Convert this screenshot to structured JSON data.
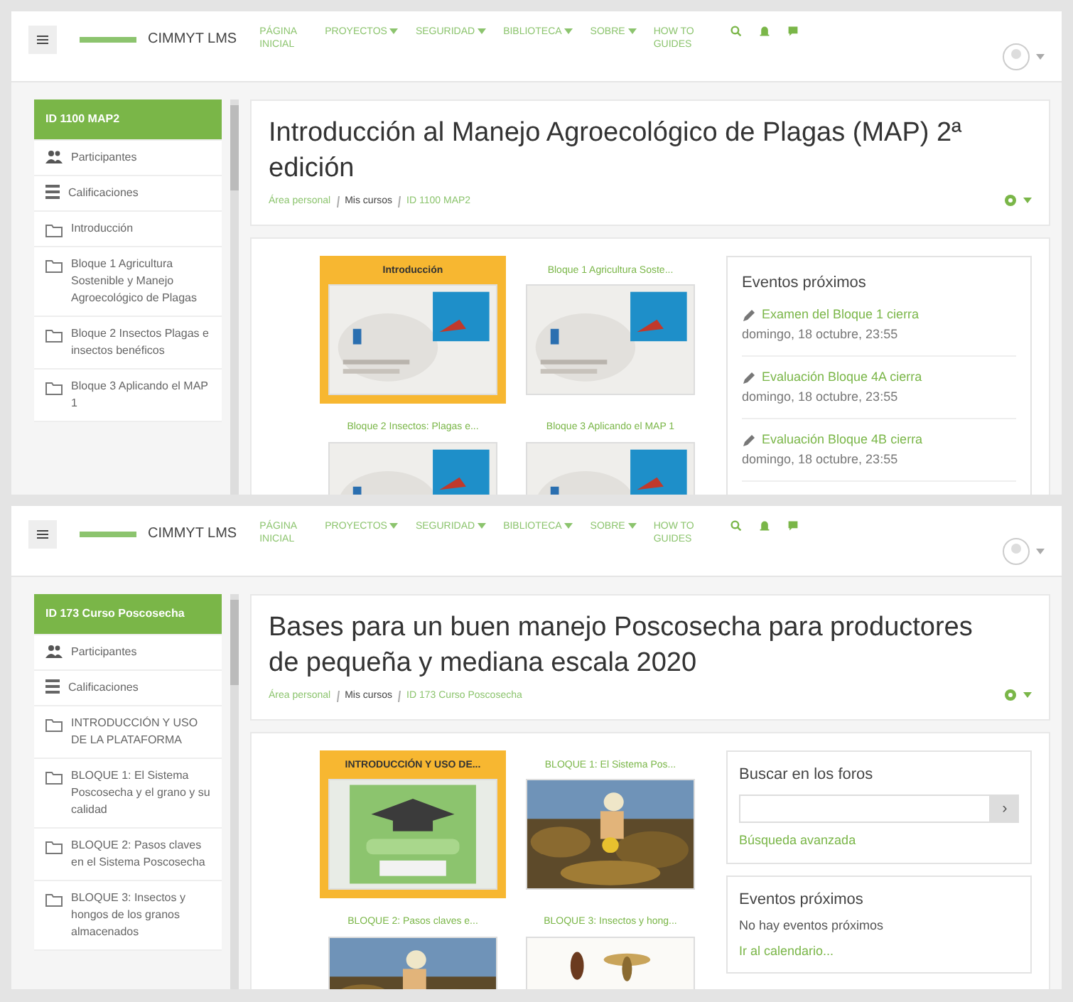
{
  "screens": [
    {
      "header": {
        "brand": "CIMMYT LMS",
        "nav": [
          {
            "label": "PÁGINA INICIAL",
            "dropdown": false
          },
          {
            "label": "PROYECTOS",
            "dropdown": true
          },
          {
            "label": "SEGURIDAD",
            "dropdown": true
          },
          {
            "label": "BIBLIOTECA",
            "dropdown": true
          },
          {
            "label": "SOBRE",
            "dropdown": true
          },
          {
            "label": "HOW TO GUIDES",
            "dropdown": false
          }
        ]
      },
      "sidebar": [
        {
          "kind": "course",
          "label": "ID 1100 MAP2",
          "selected": true
        },
        {
          "kind": "people",
          "label": "Participantes",
          "selected": false
        },
        {
          "kind": "grades",
          "label": "Calificaciones",
          "selected": false
        },
        {
          "kind": "section",
          "label": "Introducción",
          "selected": false
        },
        {
          "kind": "section",
          "label": "Bloque 1 Agricultura Sostenible y Manejo Agroecológico de Plagas",
          "selected": false
        },
        {
          "kind": "section",
          "label": "Bloque 2 Insectos Plagas e insectos benéficos",
          "selected": false
        },
        {
          "kind": "section",
          "label": "Bloque 3 Aplicando el MAP 1",
          "selected": false
        }
      ],
      "title": "Introducción al Manejo Agroecológico de Plagas (MAP) 2ª edición",
      "breadcrumb": [
        "Área personal",
        "Mis cursos",
        "ID 1100 MAP2"
      ],
      "tiles": [
        {
          "label": "Introducción",
          "selected": true
        },
        {
          "label": "Bloque 1 Agricultura Soste...",
          "selected": false
        },
        {
          "label": "Bloque 2 Insectos: Plagas e...",
          "selected": false
        },
        {
          "label": "Bloque 3 Aplicando el MAP 1",
          "selected": false
        }
      ],
      "blocks": [
        {
          "kind": "events",
          "title": "Eventos próximos",
          "events": [
            {
              "name": "Examen del Bloque 1 cierra",
              "date": "domingo, 18 octubre, 23:55"
            },
            {
              "name": "Evaluación Bloque 4A cierra",
              "date": "domingo, 18 octubre, 23:55"
            },
            {
              "name": "Evaluación Bloque 4B cierra",
              "date": "domingo, 18 octubre, 23:55"
            }
          ]
        }
      ]
    },
    {
      "header": {
        "brand": "CIMMYT LMS",
        "nav": [
          {
            "label": "PÁGINA INICIAL",
            "dropdown": false
          },
          {
            "label": "PROYECTOS",
            "dropdown": true
          },
          {
            "label": "SEGURIDAD",
            "dropdown": true
          },
          {
            "label": "BIBLIOTECA",
            "dropdown": true
          },
          {
            "label": "SOBRE",
            "dropdown": true
          },
          {
            "label": "HOW TO GUIDES",
            "dropdown": false
          }
        ]
      },
      "sidebar": [
        {
          "kind": "course",
          "label": "ID 173 Curso Poscosecha",
          "selected": true
        },
        {
          "kind": "people",
          "label": "Participantes",
          "selected": false
        },
        {
          "kind": "grades",
          "label": "Calificaciones",
          "selected": false
        },
        {
          "kind": "section",
          "label": "INTRODUCCIÓN Y USO DE LA PLATAFORMA",
          "selected": false
        },
        {
          "kind": "section",
          "label": "BLOQUE 1: El Sistema Poscosecha y el grano y su calidad",
          "selected": false
        },
        {
          "kind": "section",
          "label": "BLOQUE 2: Pasos claves en el Sistema Poscosecha",
          "selected": false
        },
        {
          "kind": "section",
          "label": "BLOQUE 3: Insectos y hongos de los granos almacenados",
          "selected": false
        }
      ],
      "title": "Bases para un buen manejo Poscosecha para productores de pequeña y mediana escala 2020",
      "breadcrumb": [
        "Área personal",
        "Mis cursos",
        "ID 173 Curso Poscosecha"
      ],
      "tiles": [
        {
          "label": "INTRODUCCIÓN Y USO DE...",
          "selected": true
        },
        {
          "label": "BLOQUE 1: El Sistema Pos...",
          "selected": false
        },
        {
          "label": "BLOQUE 2: Pasos claves e...",
          "selected": false
        },
        {
          "label": "BLOQUE 3: Insectos y hong...",
          "selected": false
        }
      ],
      "blocks": [
        {
          "kind": "search",
          "title": "Buscar en los foros",
          "button": "›",
          "link": "Búsqueda avanzada"
        },
        {
          "kind": "empty-events",
          "title": "Eventos próximos",
          "text": "No hay eventos próximos",
          "link": "Ir al calendario..."
        }
      ]
    }
  ]
}
